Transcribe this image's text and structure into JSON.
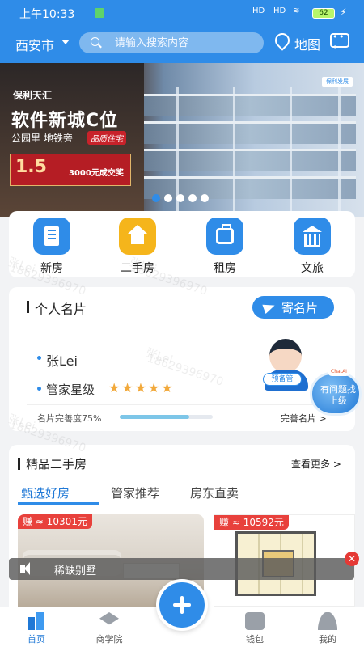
{
  "status_bar": {
    "time": "上午10:33",
    "signal1": "HD",
    "signal2": "HD",
    "battery": "62"
  },
  "header": {
    "city": "西安市",
    "search_placeholder": "请输入搜索内容",
    "map_label": "地图"
  },
  "banner": {
    "brand": "保利天汇",
    "title": "软件新城C位",
    "subtitle": "公园里 地铁旁",
    "tag": "品质住宅",
    "rate": "1.5",
    "offer": "3000元成交奖",
    "logo": "保利发展",
    "dots": 5,
    "active_dot": 0
  },
  "quick_nav": [
    {
      "label": "新房",
      "icon": "building-icon",
      "color": "#2f8ce8"
    },
    {
      "label": "二手房",
      "icon": "house-icon",
      "color": "#f5b51b"
    },
    {
      "label": "租房",
      "icon": "suitcase-icon",
      "color": "#2f8ce8"
    },
    {
      "label": "文旅",
      "icon": "temple-icon",
      "color": "#2f8ce8"
    }
  ],
  "business_card": {
    "title": "个人名片",
    "send_label": "寄名片",
    "name": "张Lei",
    "level_label": "管家星级",
    "stars": "★★★★★",
    "completion_label": "名片完善度75%",
    "completion": 0.75,
    "edit_label": "完善名片 >",
    "avatar_tag": "预备管"
  },
  "help_button": {
    "label": "有问题找上级",
    "tag": "ChatAI"
  },
  "second_hand": {
    "title": "精品二手房",
    "more_label": "查看更多 >",
    "tabs": [
      "甄选好房",
      "管家推荐",
      "房东直卖"
    ],
    "active_tab": 0,
    "listings": [
      {
        "price": "赚 ≈ 10301元"
      },
      {
        "price": "赚 ≈ 10592元"
      }
    ]
  },
  "audio_toast": {
    "text": "稀缺别墅"
  },
  "bottom_nav": [
    {
      "label": "首页",
      "icon": "home-icon",
      "active": true
    },
    {
      "label": "商学院",
      "icon": "graduation-cap-icon",
      "active": false
    },
    {
      "label": "钱包",
      "icon": "wallet-icon",
      "active": false
    },
    {
      "label": "我的",
      "icon": "user-icon",
      "active": false
    }
  ],
  "watermark": {
    "name": "张Lei",
    "phone": "18629396970"
  }
}
